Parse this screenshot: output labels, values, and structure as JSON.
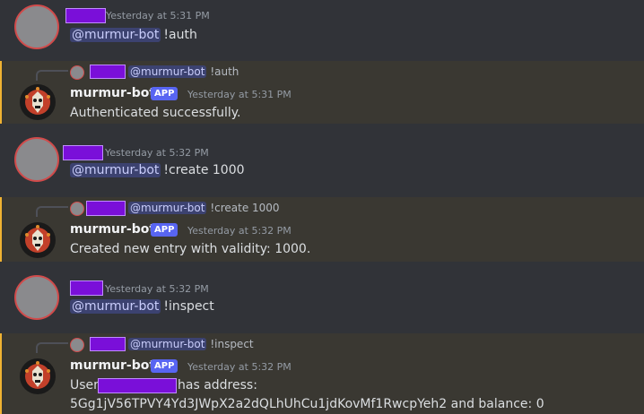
{
  "messages": [
    {
      "kind": "user",
      "timestamp": "Yesterday at 5:31 PM",
      "mention": "@murmur-bot",
      "command": "!auth"
    },
    {
      "kind": "bot",
      "reply_mention": "@murmur-bot",
      "reply_command": "!auth",
      "author": "murmur-bot",
      "badge": "APP",
      "timestamp": "Yesterday at 5:31 PM",
      "text": "Authenticated successfully."
    },
    {
      "kind": "user",
      "timestamp": "Yesterday at 5:32 PM",
      "mention": "@murmur-bot",
      "command": "!create 1000"
    },
    {
      "kind": "bot",
      "reply_mention": "@murmur-bot",
      "reply_command": "!create 1000",
      "author": "murmur-bot",
      "badge": "APP",
      "timestamp": "Yesterday at 5:32 PM",
      "text": "Created new entry with validity: 1000."
    },
    {
      "kind": "user",
      "timestamp": "Yesterday at 5:32 PM",
      "mention": "@murmur-bot",
      "command": "!inspect"
    },
    {
      "kind": "bot",
      "reply_mention": "@murmur-bot",
      "reply_command": "!inspect",
      "author": "murmur-bot",
      "badge": "APP",
      "timestamp": "Yesterday at 5:32 PM",
      "text_prefix": "User",
      "text_suffix": "has address:",
      "text_line2": "5Gg1jV56TPVY4Yd3JWpX2a2dQLhUhCu1jdKovMf1RwcpYeh2 and balance: 0"
    }
  ],
  "colors": {
    "background": "#313338",
    "bot_highlight": "#3a3832",
    "highlight_bar": "#f0b232",
    "redaction": "#7a0fd9",
    "app_badge": "#5865f2",
    "mention_bg": "#3c4270"
  }
}
